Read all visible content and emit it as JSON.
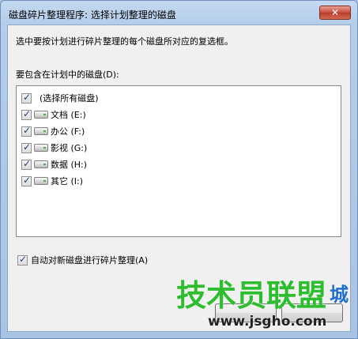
{
  "window": {
    "title": "磁盘碎片整理程序: 选择计划整理的磁盘",
    "close_glyph": "✕"
  },
  "content": {
    "instruction": "选中要按计划进行碎片整理的每个磁盘所对应的复选框。",
    "list_label": "要包含在计划中的磁盘(D):",
    "select_all": {
      "label": "(选择所有磁盘)",
      "checked": true
    },
    "disks": [
      {
        "label": "文档 (E:)",
        "checked": true,
        "icon": "drive-icon"
      },
      {
        "label": "办公 (F:)",
        "checked": true,
        "icon": "drive-icon"
      },
      {
        "label": "影视 (G:)",
        "checked": true,
        "icon": "drive-icon"
      },
      {
        "label": "数据 (H:)",
        "checked": true,
        "icon": "drive-icon"
      },
      {
        "label": "其它 (I:)",
        "checked": true,
        "icon": "drive-icon"
      }
    ],
    "auto_defrag": {
      "label": "自动对新磁盘进行碎片整理(A)",
      "checked": true
    }
  },
  "watermark": {
    "cn": "技术员联盟",
    "cn_tail": "城",
    "url": "www.jsgho.com"
  }
}
